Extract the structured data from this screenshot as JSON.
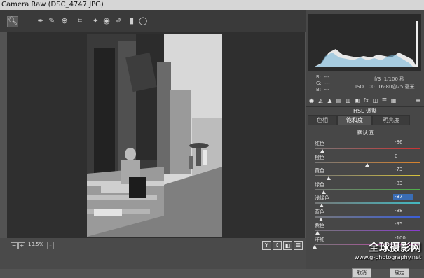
{
  "window": {
    "title": "Camera Raw (DSC_4747.JPG)"
  },
  "toolbar": {
    "tools": [
      "zoom-tool",
      "white-balance-tool",
      "color-sampler-tool",
      "targeted-adjustment-tool",
      "crop-tool",
      "spot-removal-tool",
      "red-eye-tool",
      "adjustment-brush-tool",
      "graduated-filter-tool",
      "radial-filter-tool"
    ],
    "open_preferences_icon": "export-icon"
  },
  "bottom": {
    "zoom_minus": "−",
    "zoom_plus": "+",
    "zoom_value": "13.5%",
    "zoom_dropdown": "⌄",
    "view_buttons": [
      "Y",
      "⇕",
      "◧",
      "☰"
    ]
  },
  "readout": {
    "r_label": "R:",
    "r_value": "---",
    "g_label": "G:",
    "g_value": "---",
    "b_label": "B:",
    "b_value": "---",
    "aperture": "f/3",
    "shutter": "1/100 秒",
    "iso": "ISO 100",
    "lens": "16-80@25 毫米"
  },
  "panel": {
    "title": "HSL 调整",
    "tabs": [
      {
        "label": "色相",
        "active": false
      },
      {
        "label": "饱和度",
        "active": true
      },
      {
        "label": "明亮度",
        "active": false
      }
    ],
    "default_label": "默认值",
    "sliders": [
      {
        "label": "红色",
        "value": "-86",
        "fraction": 0.07,
        "color": "#c33"
      },
      {
        "label": "橙色",
        "value": "0",
        "fraction": 0.5,
        "color": "#d9822b"
      },
      {
        "label": "黄色",
        "value": "-73",
        "fraction": 0.135,
        "color": "#d8c23b"
      },
      {
        "label": "绿色",
        "value": "-83",
        "fraction": 0.085,
        "color": "#4fb04a"
      },
      {
        "label": "浅绿色",
        "value": "-87",
        "fraction": 0.065,
        "color": "#43b8c0",
        "selected": true
      },
      {
        "label": "蓝色",
        "value": "-88",
        "fraction": 0.06,
        "color": "#3b5ed8"
      },
      {
        "label": "紫色",
        "value": "-95",
        "fraction": 0.025,
        "color": "#8a3bd0"
      },
      {
        "label": "洋红",
        "value": "-100",
        "fraction": 0.0,
        "color": "#c63bb0"
      }
    ]
  },
  "footer": {
    "cancel": "取消",
    "ok": "确定"
  },
  "watermark": {
    "title": "全球摄影网",
    "url": "www.g-photography.net"
  },
  "colors": {
    "accent": "#3a6db5",
    "panel_bg": "#474747",
    "canvas_bg": "#2f2f2f"
  }
}
